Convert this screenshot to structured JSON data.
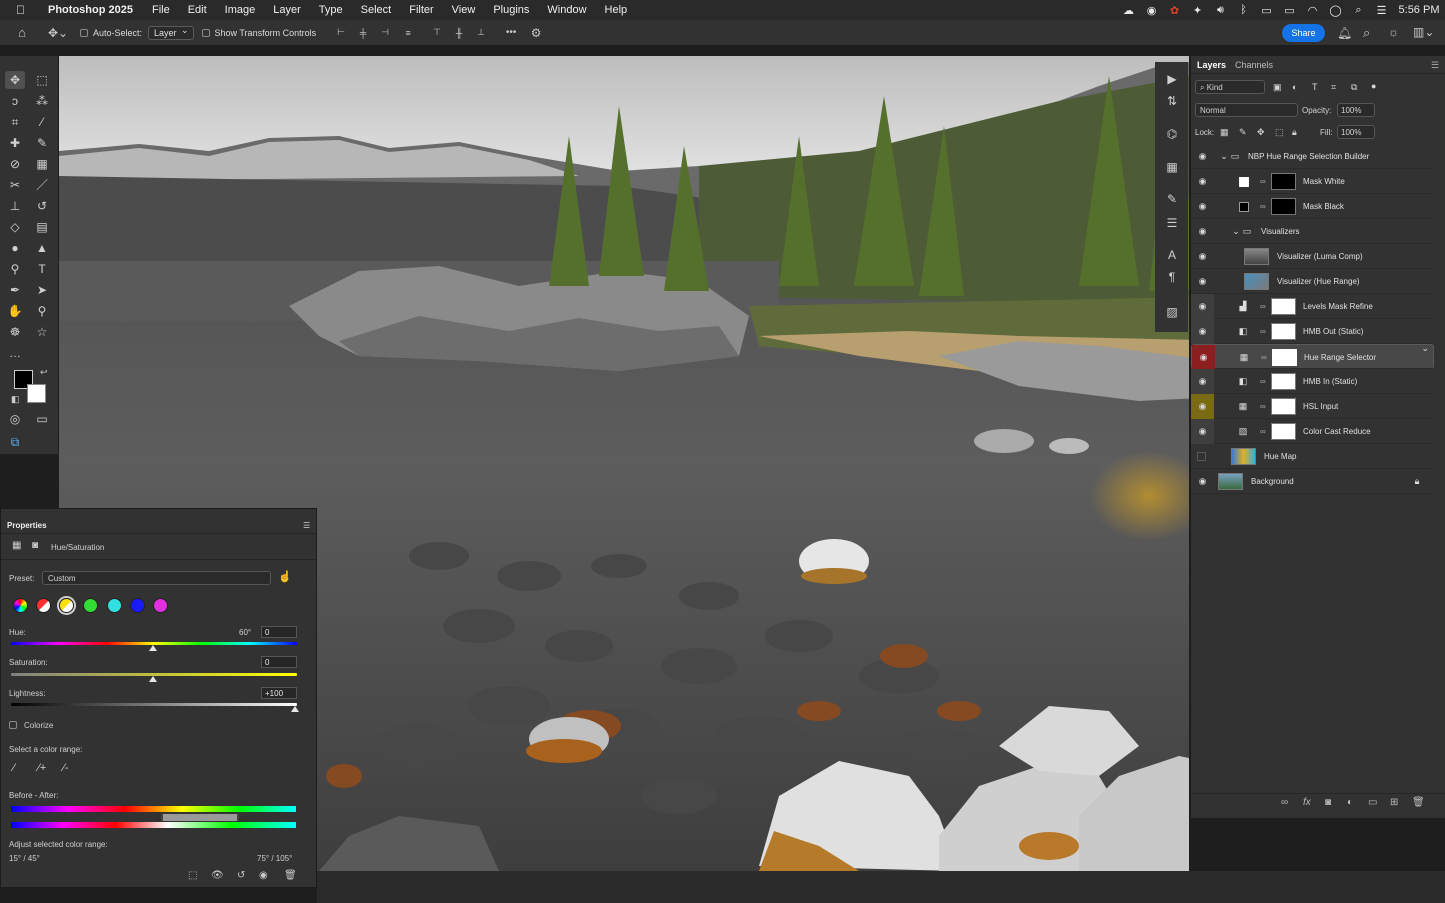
{
  "menubar": {
    "app_name": "Photoshop 2025",
    "items": [
      "File",
      "Edit",
      "Image",
      "Layer",
      "Type",
      "Select",
      "Filter",
      "View",
      "Plugins",
      "Window",
      "Help"
    ],
    "clock": "5:56 PM"
  },
  "options": {
    "auto_select_label": "Auto-Select:",
    "auto_select_value": "Layer",
    "transform_label": "Show Transform Controls",
    "share_label": "Share",
    "more_label": "•••"
  },
  "layers_panel": {
    "tabs": [
      "Layers",
      "Channels"
    ],
    "kind_label": "Kind",
    "blend_mode": "Normal",
    "opacity_label": "Opacity:",
    "opacity_value": "100%",
    "lock_label": "Lock:",
    "fill_label": "Fill:",
    "fill_value": "100%",
    "layers": [
      {
        "name": "NBP Hue Range Selection Builder"
      },
      {
        "name": "Mask White"
      },
      {
        "name": "Mask Black"
      },
      {
        "name": "Visualizers"
      },
      {
        "name": "Visualizer (Luma Comp)"
      },
      {
        "name": "Visualizer (Hue Range)"
      },
      {
        "name": "Levels Mask Refine"
      },
      {
        "name": "HMB Out (Static)"
      },
      {
        "name": "Hue Range Selector"
      },
      {
        "name": "HMB In (Static)"
      },
      {
        "name": "HSL Input"
      },
      {
        "name": "Color Cast Reduce"
      },
      {
        "name": "Hue Map"
      },
      {
        "name": "Background"
      }
    ],
    "colors": {
      "red_tag": "#8b1f1f",
      "yellow_tag": "#7a6a14",
      "selected_bg": "#484848"
    }
  },
  "properties": {
    "title": "Properties",
    "adjustment": "Hue/Saturation",
    "preset_label": "Preset:",
    "preset_value": "Custom",
    "hue_label": "Hue:",
    "hue_degree": "60°",
    "hue_value": "0",
    "saturation_label": "Saturation:",
    "saturation_value": "0",
    "lightness_label": "Lightness:",
    "lightness_value": "+100",
    "colorize_label": "Colorize",
    "color_range_label": "Select a color range:",
    "before_after_label": "Before - After:",
    "adjust_label": "Adjust selected color range:",
    "range_left": "15° / 45°",
    "range_right": "75° / 105°",
    "swatch_colors": [
      "#ff3030",
      "#ffe000",
      "#33dd33",
      "#33e0e0",
      "#1a1aff",
      "#e030e0"
    ]
  }
}
